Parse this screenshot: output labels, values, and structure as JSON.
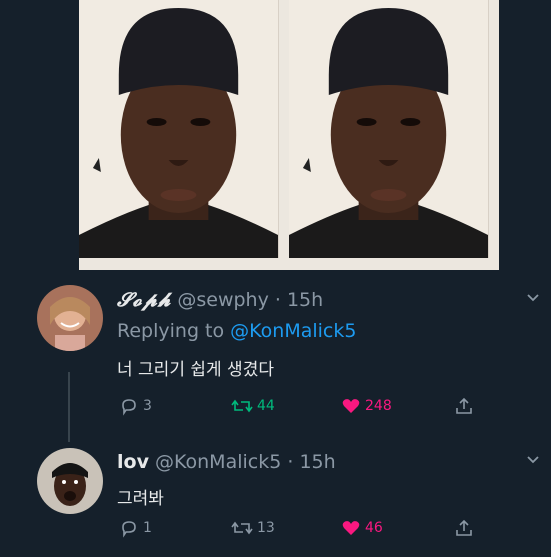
{
  "tweets": [
    {
      "display_name": "𝓢𝓸𝓹𝓱",
      "handle": "@sewphy",
      "time": "· 15h",
      "replying_prefix": "Replying to ",
      "replying_mention": "@KonMalick5",
      "text": "너 그리기 쉽게 생겼다",
      "replies": "3",
      "retweets": "44",
      "likes": "248"
    },
    {
      "display_name": "lov",
      "handle": "@KonMalick5",
      "time": "· 15h",
      "text": "그려봐",
      "replies": "1",
      "retweets": "13",
      "likes": "46"
    }
  ],
  "colors": {
    "background": "#15202b",
    "accent": "#1d9bf0",
    "like": "#f91880",
    "retweet": "#00ba7c",
    "muted": "#8b98a5"
  }
}
